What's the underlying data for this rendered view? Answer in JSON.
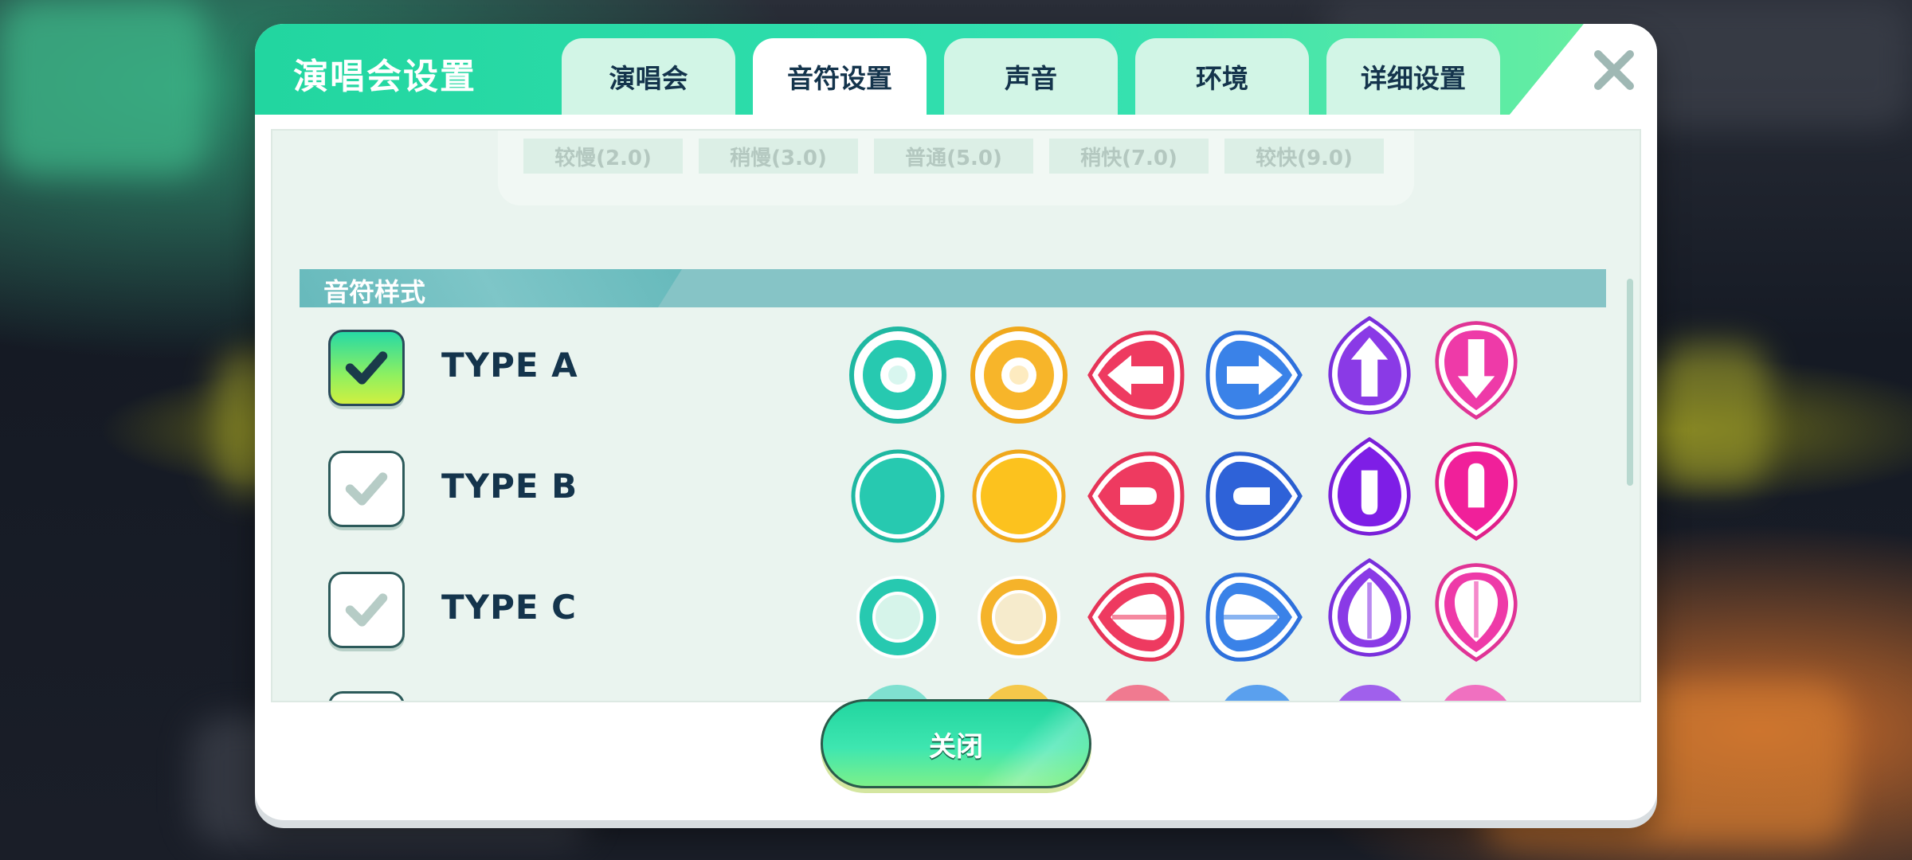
{
  "dialog": {
    "title": "演唱会设置",
    "tabs": [
      {
        "label": "演唱会",
        "active": false
      },
      {
        "label": "音符设置",
        "active": true
      },
      {
        "label": "声音",
        "active": false
      },
      {
        "label": "环境",
        "active": false
      },
      {
        "label": "详细设置",
        "active": false
      }
    ],
    "close_icon": "close-x-icon"
  },
  "speed": {
    "options": [
      "较慢(2.0)",
      "稍慢(3.0)",
      "普通(5.0)",
      "稍快(7.0)",
      "较快(9.0)"
    ]
  },
  "note_style": {
    "section_title": "音符样式",
    "types": [
      {
        "label": "TYPE A",
        "checked": true
      },
      {
        "label": "TYPE B",
        "checked": false
      },
      {
        "label": "TYPE C",
        "checked": false
      }
    ],
    "note_colors": {
      "tap": "#22c9b4",
      "hold": "#f5b820",
      "left": "#ee3a60",
      "right": "#3a7ee6",
      "up": "#8a3ae6",
      "down": "#ee3aa0"
    }
  },
  "footer": {
    "close_label": "关闭"
  }
}
